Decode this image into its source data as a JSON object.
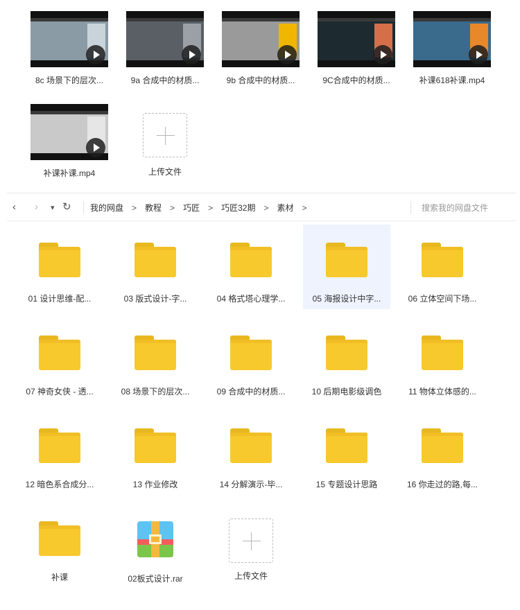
{
  "videos": [
    {
      "label": "8c 场景下的层次...",
      "screen": "#8a9ba6",
      "accent": "#c9d4da"
    },
    {
      "label": "9a 合成中的材质...",
      "screen": "#5a5f66",
      "accent": "#9aa0a6"
    },
    {
      "label": "9b 合成中的材质...",
      "screen": "#9a9a9a",
      "accent": "#f0b700"
    },
    {
      "label": "9C合成中的材质...",
      "screen": "#1d2a2f",
      "accent": "#d56f4a"
    },
    {
      "label": "补课618补课.mp4",
      "screen": "#3a6a8c",
      "accent": "#e8882a"
    },
    {
      "label": "补课补课.mp4",
      "screen": "#c9c9c9",
      "accent": "#e6e6e6"
    }
  ],
  "upload_top": {
    "label": "上传文件"
  },
  "nav": {
    "back_icon": "‹",
    "forward_icon": "›",
    "dropdown_icon": "▾",
    "refresh_icon": "↻",
    "breadcrumbs": [
      "我的网盘",
      "教程",
      "巧匠",
      "巧匠32期",
      "素材"
    ],
    "separator": ">",
    "search_placeholder": "搜索我的网盘文件"
  },
  "files": [
    {
      "label": "01 设计思维-配...",
      "type": "folder"
    },
    {
      "label": "03 版式设计-字...",
      "type": "folder"
    },
    {
      "label": "04 格式塔心理学...",
      "type": "folder"
    },
    {
      "label": "05 海报设计中字...",
      "type": "folder",
      "selected": true
    },
    {
      "label": "06 立体空间下场...",
      "type": "folder"
    },
    {
      "label": "07 神奇女侠 - 透...",
      "type": "folder"
    },
    {
      "label": "08 场景下的层次...",
      "type": "folder"
    },
    {
      "label": "09 合成中的材质...",
      "type": "folder"
    },
    {
      "label": "10 后期电影级调色",
      "type": "folder"
    },
    {
      "label": "11 物体立体感的...",
      "type": "folder"
    },
    {
      "label": "12 暗色系合成分...",
      "type": "folder"
    },
    {
      "label": "13 作业修改",
      "type": "folder"
    },
    {
      "label": "14 分解演示-毕...",
      "type": "folder"
    },
    {
      "label": "15 专题设计思路",
      "type": "folder"
    },
    {
      "label": "16 你走过的路,每...",
      "type": "folder"
    },
    {
      "label": "补课",
      "type": "folder"
    },
    {
      "label": "02板式设计.rar",
      "type": "rar"
    },
    {
      "label": "上传文件",
      "type": "upload"
    }
  ],
  "colors": {
    "folder": "#f8c92d",
    "selected_bg": "#eef3fe"
  }
}
